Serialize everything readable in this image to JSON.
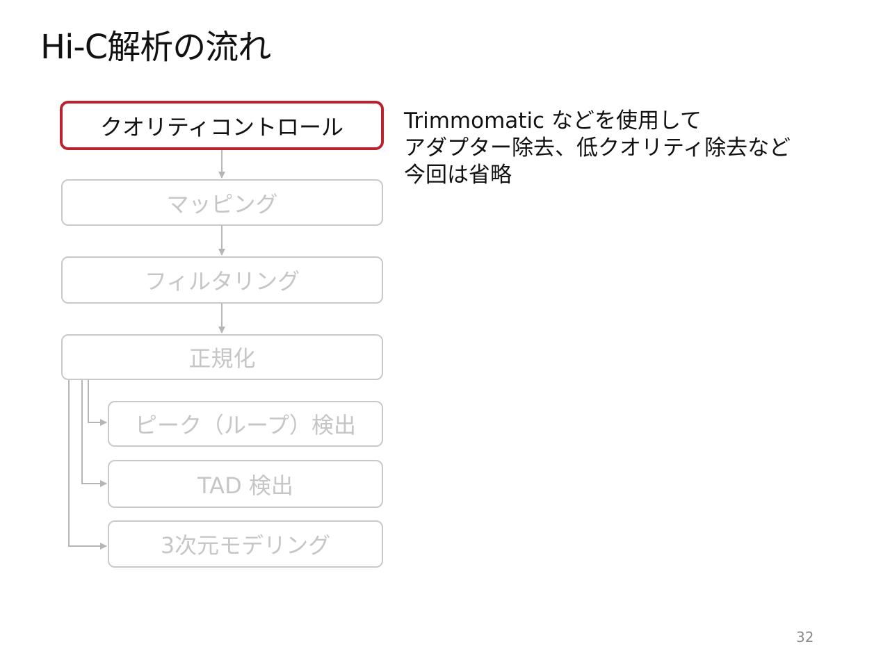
{
  "slide": {
    "title": "Hi-C解析の流れ",
    "page_number": "32"
  },
  "workflow": {
    "steps": [
      {
        "label": "クオリティコントロール",
        "state": "active"
      },
      {
        "label": "マッピング",
        "state": "inactive"
      },
      {
        "label": "フィルタリング",
        "state": "inactive"
      },
      {
        "label": "正規化",
        "state": "inactive"
      }
    ],
    "downstream": [
      {
        "label": "ピーク（ループ）検出",
        "state": "inactive"
      },
      {
        "label": "TAD 検出",
        "state": "inactive"
      },
      {
        "label": "3次元モデリング",
        "state": "inactive"
      }
    ]
  },
  "description": {
    "lines": [
      "Trimmomatic などを使用して",
      "アダプター除去、低クオリティ除去など",
      "今回は省略"
    ]
  },
  "colors": {
    "active_border": "#b8232f",
    "inactive_border": "#c9c9c9",
    "inactive_text": "#c6c6c6",
    "connector": "#b5b5b5"
  }
}
